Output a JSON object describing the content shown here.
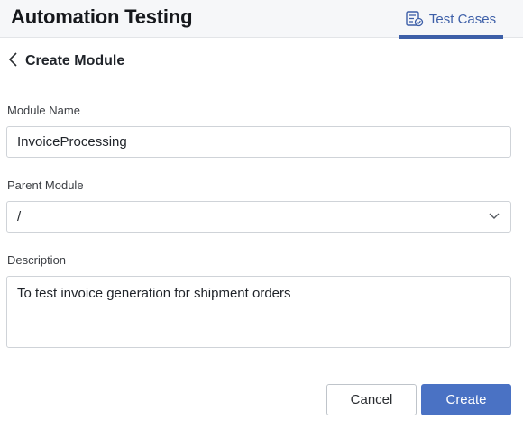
{
  "app": {
    "title": "Automation Testing"
  },
  "nav": {
    "tab_label": "Test Cases",
    "accent": "#3d5fa8"
  },
  "page": {
    "title": "Create Module"
  },
  "form": {
    "module_name": {
      "label": "Module Name",
      "value": "InvoiceProcessing"
    },
    "parent_module": {
      "label": "Parent Module",
      "value": "/"
    },
    "description": {
      "label": "Description",
      "value": "To test invoice generation for shipment orders"
    }
  },
  "actions": {
    "cancel_label": "Cancel",
    "create_label": "Create",
    "primary_color": "#4a72c4"
  },
  "icons": {
    "back": "chevron-left-icon",
    "tab": "test-cases-icon",
    "select": "chevron-down-icon"
  }
}
